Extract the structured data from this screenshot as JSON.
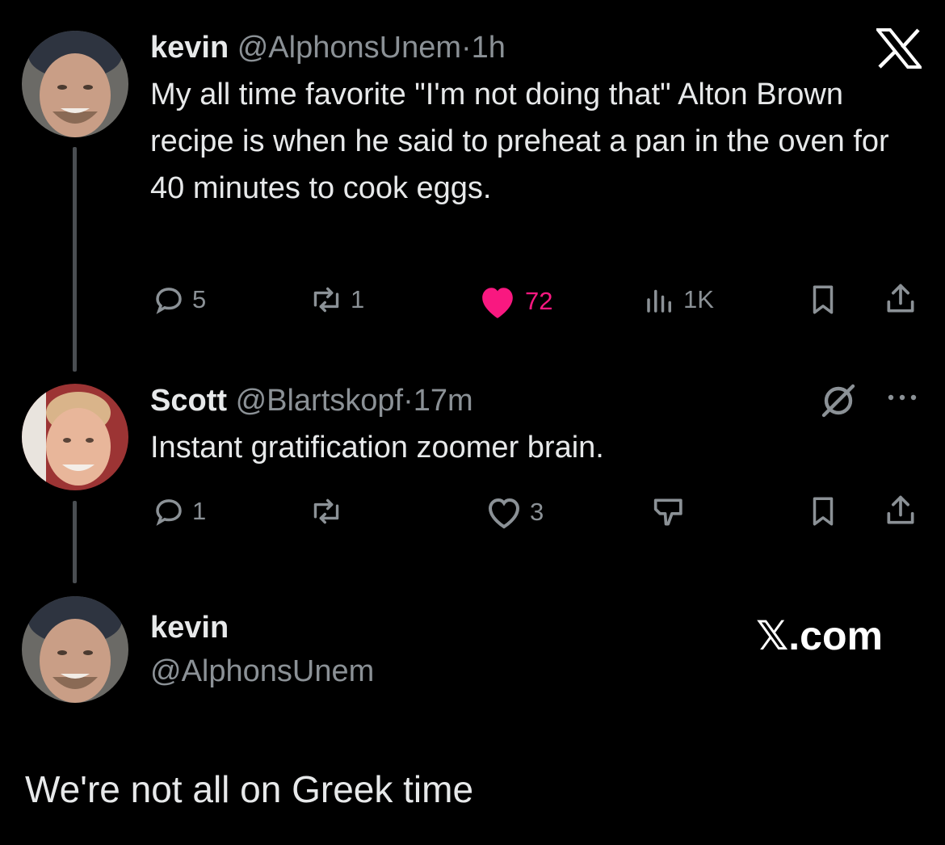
{
  "tweet1": {
    "name": "kevin",
    "handle": "@AlphonsUnem",
    "sep": "·",
    "time": "1h",
    "text": "My all time favorite \"I'm not doing that\" Alton Brown recipe is when he said to preheat a pan in the oven for 40 minutes to cook eggs.",
    "replies": "5",
    "reposts": "1",
    "likes": "72",
    "views": "1K"
  },
  "tweet2": {
    "name": "Scott",
    "handle": "@Blartskopf",
    "sep": "·",
    "time": "17m",
    "text": "Instant gratification zoomer brain.",
    "replies": "1",
    "reposts": "",
    "likes": "3"
  },
  "reply": {
    "name": "kevin",
    "handle": "@AlphonsUnem",
    "brand": "𝕏.com",
    "text": "We're not all on Greek time"
  },
  "colors": {
    "like": "#f91880",
    "muted": "#8b9196",
    "text": "#e7e9ea",
    "background": "#000000"
  }
}
